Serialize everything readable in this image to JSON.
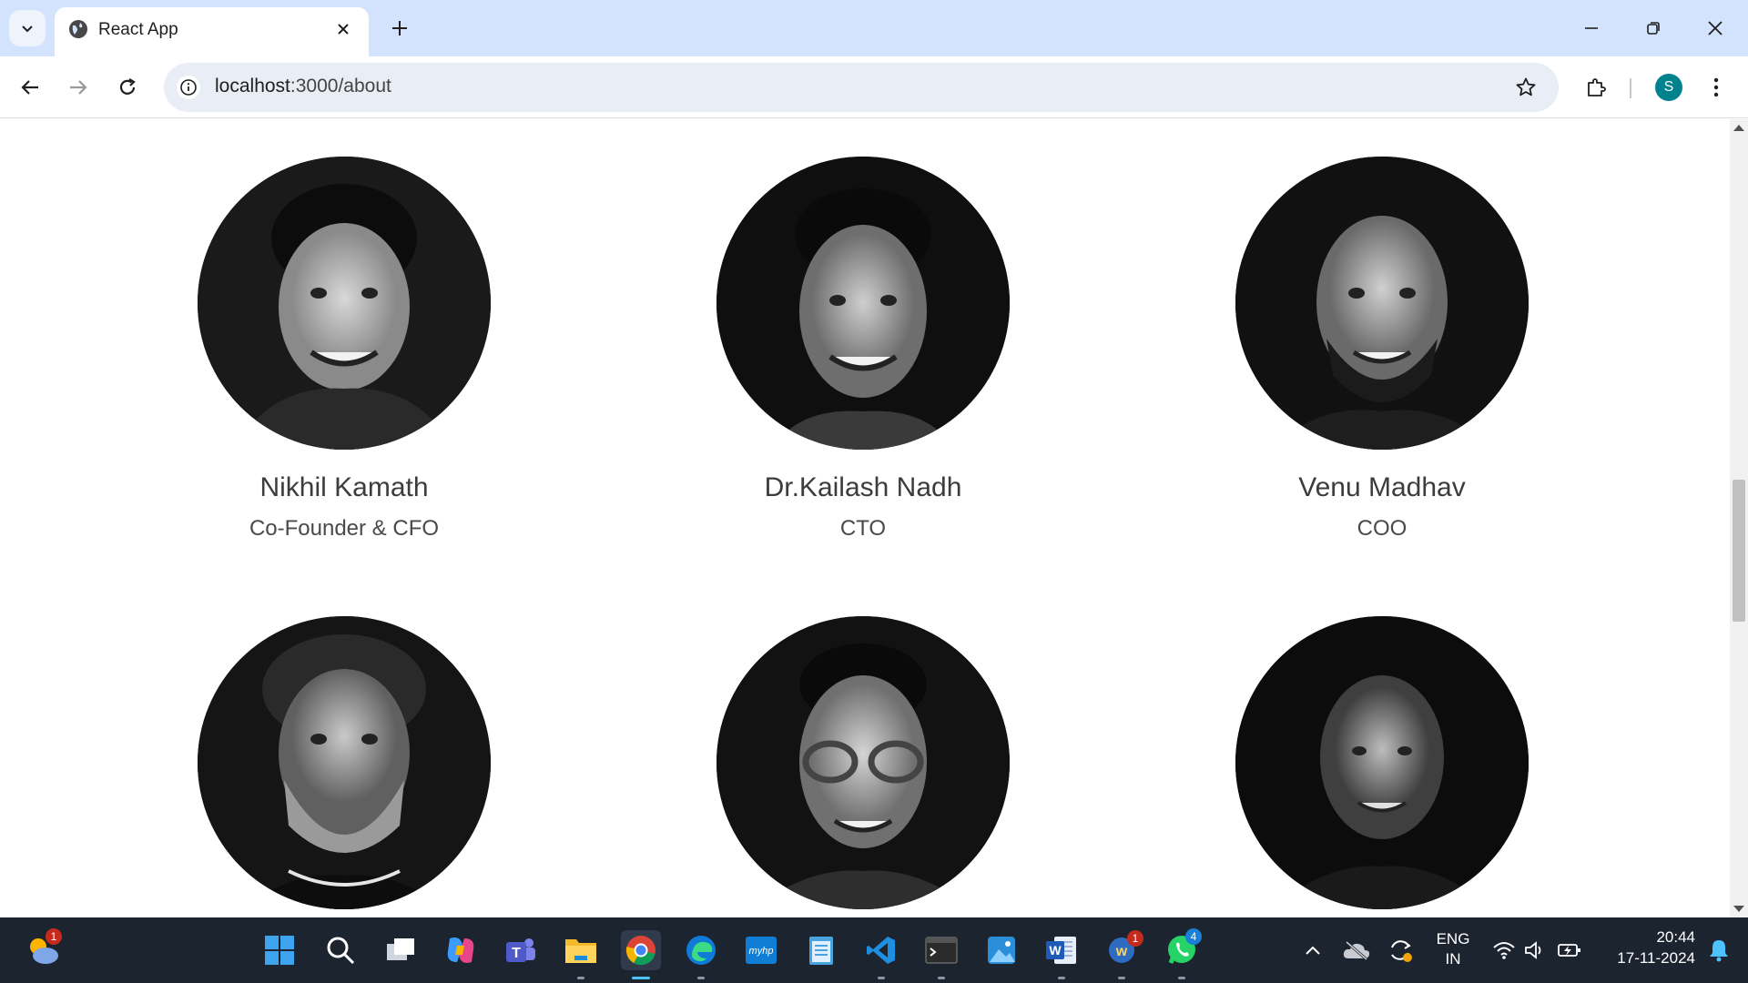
{
  "browser": {
    "tab_title": "React App",
    "url_host": "localhost",
    "url_path": ":3000/about",
    "profile_initial": "S"
  },
  "page": {
    "team": [
      {
        "name": "Nikhil Kamath",
        "role": "Co-Founder & CFO"
      },
      {
        "name": "Dr.Kailash Nadh",
        "role": "CTO"
      },
      {
        "name": "Venu Madhav",
        "role": "COO"
      },
      {
        "name": "",
        "role": ""
      },
      {
        "name": "",
        "role": ""
      },
      {
        "name": "",
        "role": ""
      }
    ]
  },
  "taskbar": {
    "weather_badge": "1",
    "wordweb_badge": "1",
    "whatsapp_badge": "4",
    "lang_line1": "ENG",
    "lang_line2": "IN",
    "time": "20:44",
    "date": "17-11-2024"
  },
  "colors": {
    "tabbar_bg": "#d3e3fd",
    "omnibox_bg": "#e9eef6",
    "profile_bg": "#00838f",
    "taskbar_bg": "#1c2430",
    "accent_blue": "#4cc2ff"
  }
}
